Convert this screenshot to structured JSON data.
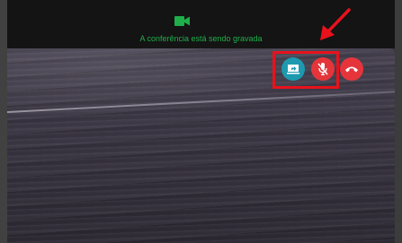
{
  "recording": {
    "icon": "video-camera-icon",
    "notice": "A conferência está sendo gravada",
    "color": "#1fae4a"
  },
  "controls": [
    {
      "name": "share-screen-button",
      "icon": "screen-share-icon",
      "color": "#1d9aaf"
    },
    {
      "name": "mute-microphone-button",
      "icon": "microphone-off-icon",
      "color": "#e5353b"
    },
    {
      "name": "hang-up-button",
      "icon": "phone-hangup-icon",
      "color": "#e5353b"
    }
  ],
  "annotation": {
    "highlight_color": "#e8121c",
    "arrow_icon": "arrow-icon"
  }
}
